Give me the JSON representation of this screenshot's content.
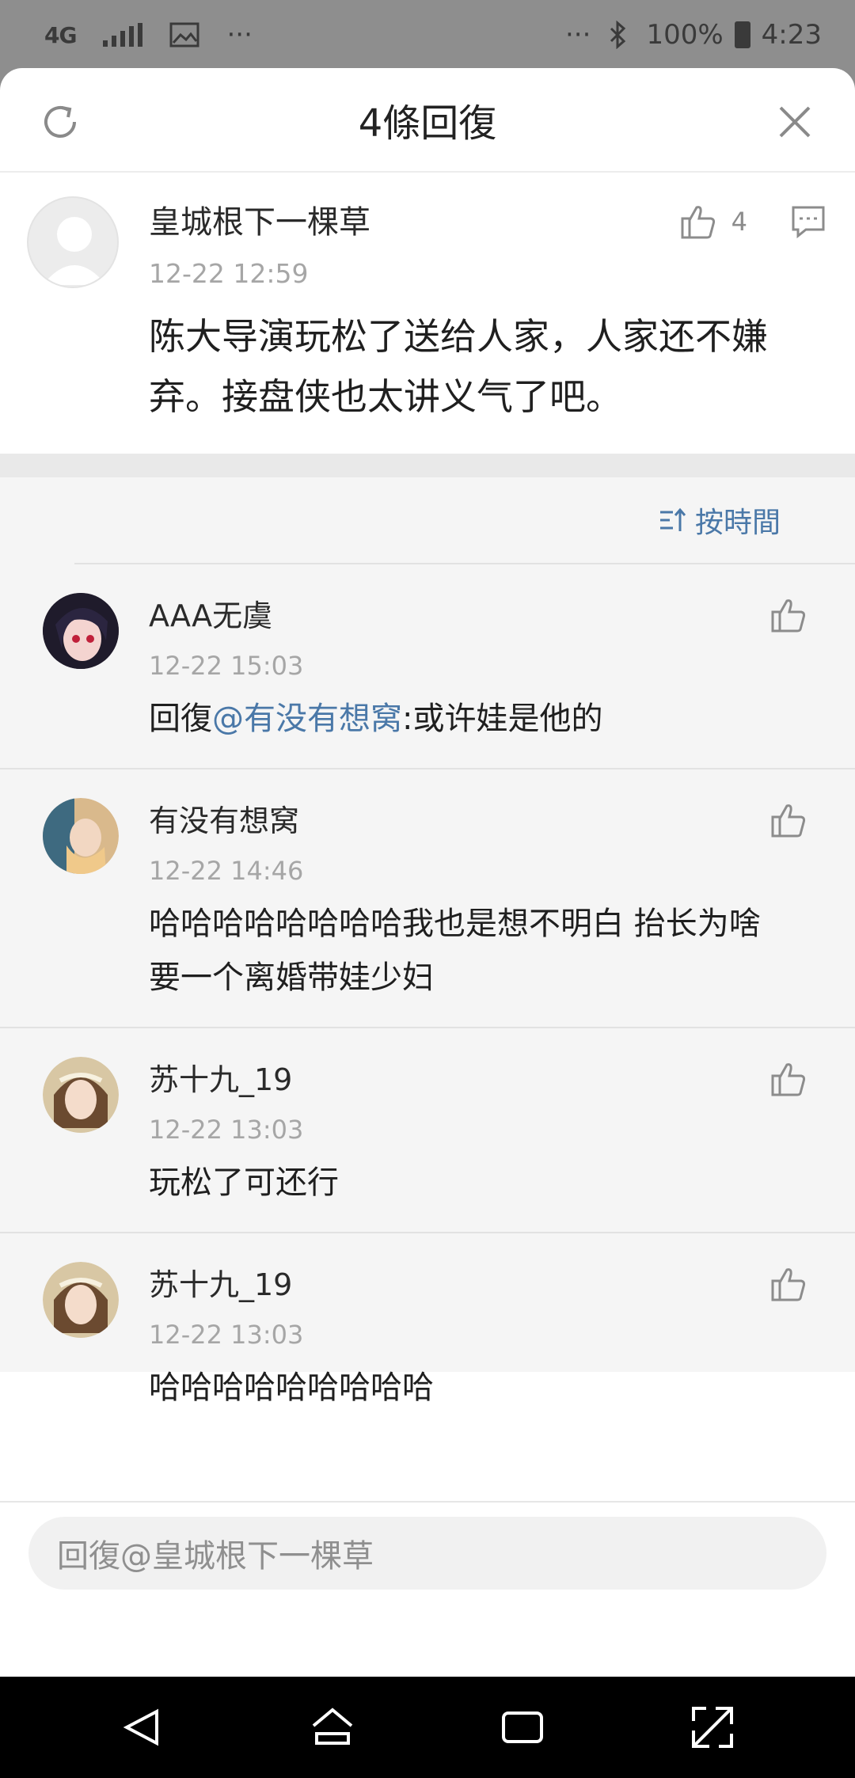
{
  "status_bar": {
    "network": "4G",
    "more_left": "···",
    "more_right": "···",
    "battery": "100%",
    "time": "4:23"
  },
  "header": {
    "title": "4條回復"
  },
  "main_comment": {
    "user": "皇城根下一棵草",
    "time": "12-22 12:59",
    "text": "陈大导演玩松了送给人家，人家还不嫌弃。接盘侠也太讲义气了吧。",
    "likes": "4"
  },
  "sort": {
    "label": "按時間"
  },
  "replies": [
    {
      "user": "AAA无虞",
      "time": "12-22 15:03",
      "prefix": "回復",
      "mention": "@有没有想窝",
      "text": ":或许娃是他的"
    },
    {
      "user": "有没有想窝",
      "time": "12-22 14:46",
      "text": "哈哈哈哈哈哈哈哈我也是想不明白 抬长为啥要一个离婚带娃少妇"
    },
    {
      "user": "苏十九_19",
      "time": "12-22 13:03",
      "text": "玩松了可还行"
    },
    {
      "user": "苏十九_19",
      "time": "12-22 13:03",
      "text": "哈哈哈哈哈哈哈哈哈"
    }
  ],
  "input": {
    "placeholder": "回復@皇城根下一棵草"
  },
  "colors": {
    "accent": "#4a78a8",
    "status_bar_bg": "#8e8e8e",
    "replies_bg": "#f5f5f5"
  }
}
